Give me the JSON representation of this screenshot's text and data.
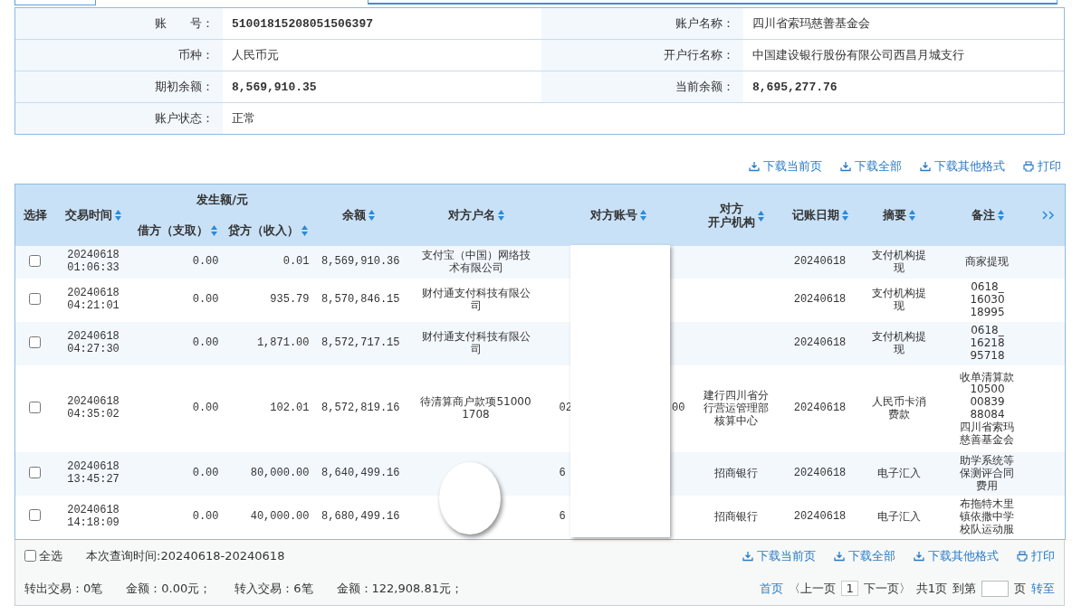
{
  "account_info": [
    {
      "label": "账　　号：",
      "value": "51001815208051506397",
      "kind": "number"
    },
    {
      "label": "账户名称：",
      "value": "四川省索玛慈善基金会",
      "kind": "text"
    },
    {
      "label": "币种：",
      "value": "人民币元",
      "kind": "text"
    },
    {
      "label": "开户行名称：",
      "value": "中国建设银行股份有限公司西昌月城支行",
      "kind": "text"
    },
    {
      "label": "期初余额：",
      "value": "8,569,910.35",
      "kind": "number"
    },
    {
      "label": "当前余额：",
      "value": "8,695,277.76",
      "kind": "number"
    },
    {
      "label": "账户状态：",
      "value": "正常",
      "kind": "text"
    }
  ],
  "toolbar": [
    {
      "label": "下载当前页",
      "kind": "download"
    },
    {
      "label": "下载全部",
      "kind": "download"
    },
    {
      "label": "下载其他格式",
      "kind": "download"
    },
    {
      "label": "打印",
      "kind": "print"
    }
  ],
  "table": {
    "columns": [
      {
        "kind": "column",
        "lines": [
          "选择"
        ],
        "sortable": false
      },
      {
        "kind": "column",
        "lines": [
          "交易时间"
        ],
        "sortable": true
      },
      {
        "kind": "group",
        "label": "发生额/元",
        "children": [
          {
            "kind": "column",
            "lines": [
              "借方（支取）"
            ],
            "sortable": true
          },
          {
            "kind": "column",
            "lines": [
              "贷方（收入）"
            ],
            "sortable": true
          }
        ]
      },
      {
        "kind": "column",
        "lines": [
          "余额"
        ],
        "sortable": true
      },
      {
        "kind": "column",
        "lines": [
          "对方户名"
        ],
        "sortable": true
      },
      {
        "kind": "column",
        "lines": [
          "对方账号"
        ],
        "sortable": true
      },
      {
        "kind": "column",
        "lines": [
          "对方",
          "开户机构"
        ],
        "sortable": true
      },
      {
        "kind": "column",
        "lines": [
          "记账日期"
        ],
        "sortable": true
      },
      {
        "kind": "column",
        "lines": [
          "摘要"
        ],
        "sortable": true
      },
      {
        "kind": "column",
        "lines": [
          "备注"
        ],
        "sortable": true
      }
    ],
    "rows": [
      {
        "selected": false,
        "time": "20240618 01:06:33",
        "debit": "0.00",
        "credit": "0.01",
        "balance": "8,569,910.36",
        "counterparty_name": "支付宝（中国）网络技术有限公司",
        "posting_date": "20240618",
        "summary": "支付机构提现",
        "remark": "商家提现"
      },
      {
        "selected": false,
        "time": "20240618 04:21:01",
        "debit": "0.00",
        "credit": "935.79",
        "balance": "8,570,846.15",
        "counterparty_name": "财付通支付科技有限公司",
        "posting_date": "20240618",
        "summary": "支付机构提现",
        "remark": "0618_\n16030\n18995"
      },
      {
        "selected": false,
        "time": "20240618 04:27:30",
        "debit": "0.00",
        "credit": "1,871.00",
        "balance": "8,572,717.15",
        "counterparty_name": "财付通支付科技有限公司",
        "posting_date": "20240618",
        "summary": "支付机构提现",
        "remark": "0618_\n16218\n95718"
      },
      {
        "selected": false,
        "time": "20240618 04:35:02",
        "debit": "0.00",
        "credit": "102.01",
        "balance": "8,572,819.16",
        "counterparty_name": "待清算商户款项510001708",
        "account_start": "02",
        "account_end": "00",
        "counterparty_bank": "建行四川省分行营运管理部核算中心",
        "posting_date": "20240618",
        "summary": "人民币卡消费款",
        "remark": "收单清算款\n10500\n00839\n88084\n四川省索玛慈善基金会"
      },
      {
        "selected": false,
        "time": "20240618 13:45:27",
        "debit": "0.00",
        "credit": "80,000.00",
        "balance": "8,640,499.16",
        "account_start": "6",
        "counterparty_bank": "招商银行",
        "posting_date": "20240618",
        "summary": "电子汇入",
        "remark": "助学系统等保测评合同费用"
      },
      {
        "selected": false,
        "time": "20240618 14:18:09",
        "debit": "0.00",
        "credit": "40,000.00",
        "balance": "8,680,499.16",
        "account_start": "6",
        "counterparty_bank": "招商银行",
        "posting_date": "20240618",
        "summary": "电子汇入",
        "remark": "布拖特木里镇依撒中学校队运动服"
      }
    ],
    "redactions": [
      {
        "kind": "rectangle"
      },
      {
        "kind": "circle"
      }
    ]
  },
  "footer": {
    "select_all": {
      "label": "全选",
      "checked": false
    },
    "query_time": "本次查询时间:20240618-20240618",
    "links": [
      {
        "label": "下载当前页",
        "kind": "download"
      },
      {
        "label": "下载全部",
        "kind": "download"
      },
      {
        "label": "下载其他格式",
        "kind": "download"
      },
      {
        "label": "打印",
        "kind": "print"
      }
    ],
    "totals": [
      "转出交易：0笔",
      "金额：0.00元；",
      "转入交易：6笔",
      "金额：122,908.81元；"
    ],
    "pagination": {
      "first": "首页",
      "prev": {
        "label": "〈上一页",
        "disabled": true
      },
      "current": "1",
      "next": {
        "label": "下一页〉",
        "disabled": true
      },
      "total": "共1页",
      "goto_prefix": "到第",
      "goto_suffix": "页",
      "go": "转至"
    }
  }
}
